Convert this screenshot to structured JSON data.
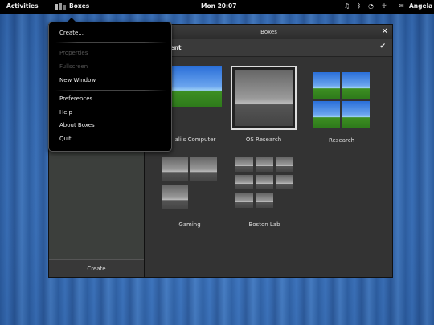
{
  "topbar": {
    "activities": "Activities",
    "app_name": "Boxes",
    "clock": "Mon 20:07",
    "user": "Angela",
    "volume_icon": "volume-icon",
    "bluetooth_icon": "bluetooth-icon",
    "wifi_icon": "wifi-icon",
    "accessibility_icon": "accessibility-icon",
    "chat_icon": "chat-icon"
  },
  "window": {
    "title": "Boxes",
    "collection_title": "nd Recent",
    "create_label": "Create"
  },
  "app_menu": {
    "items": [
      {
        "label": "Create...",
        "enabled": true
      },
      {
        "label": "Properties",
        "enabled": false
      },
      {
        "label": "Fullscreen",
        "enabled": false
      },
      {
        "label": "New Window",
        "enabled": true
      },
      {
        "label": "Preferences",
        "enabled": true
      },
      {
        "label": "Help",
        "enabled": true
      },
      {
        "label": "About Boxes",
        "enabled": true
      },
      {
        "label": "Quit",
        "enabled": true
      }
    ]
  },
  "items": [
    {
      "label": "ali's Computer"
    },
    {
      "label": "OS Research"
    },
    {
      "label": "Research"
    },
    {
      "label": "Gaming"
    },
    {
      "label": "Boston Lab"
    }
  ]
}
